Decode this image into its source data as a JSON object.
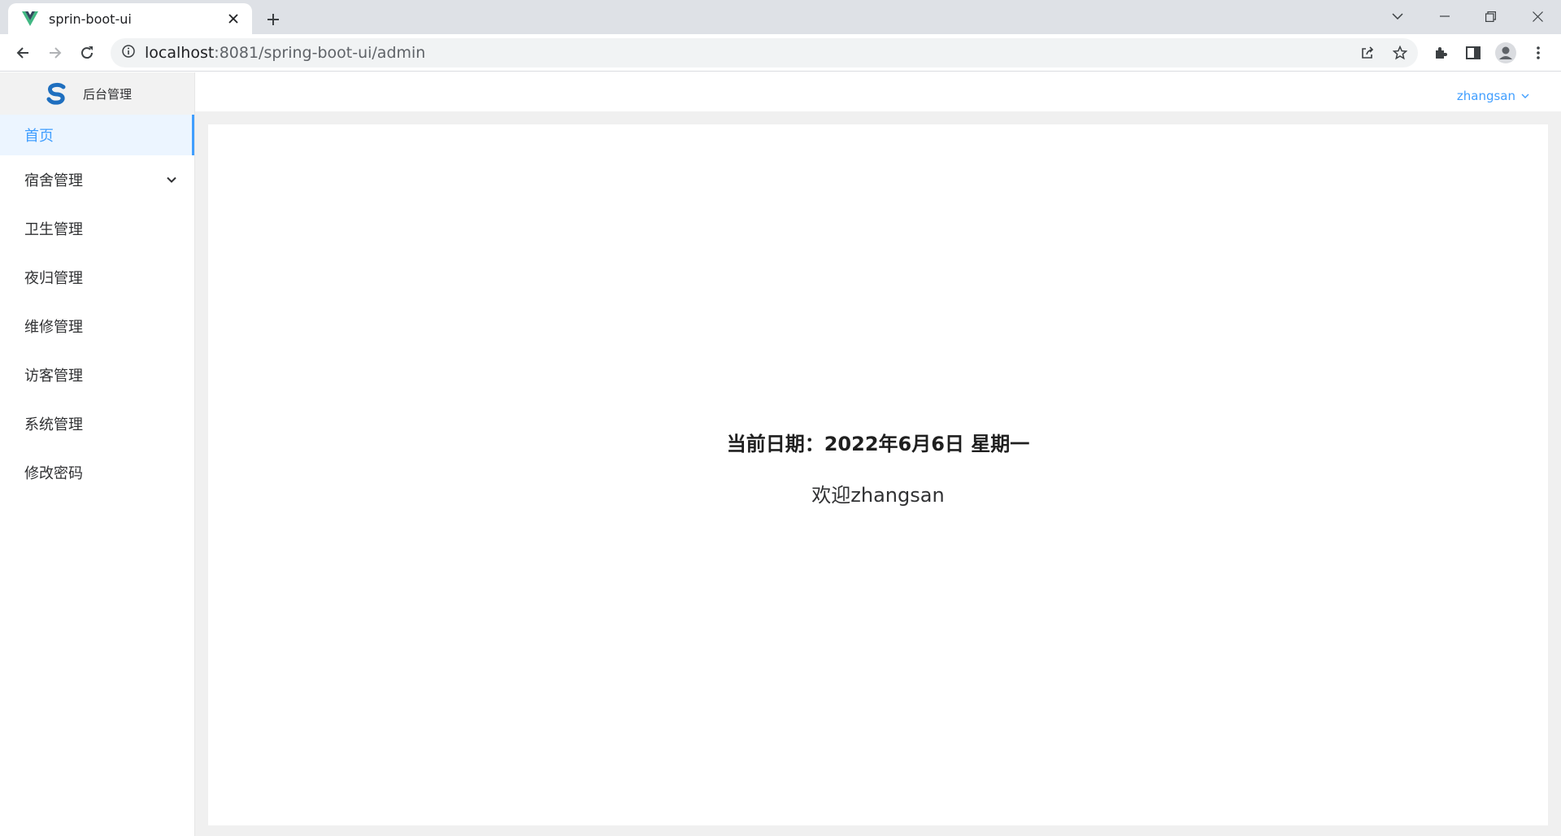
{
  "browser": {
    "tab_title": "sprin-boot-ui",
    "url_host": "localhost",
    "url_rest": ":8081/spring-boot-ui/admin"
  },
  "app": {
    "logo_text": "后台管理",
    "user_name": "zhangsan",
    "accent_color": "#409eff"
  },
  "sidebar": {
    "items": [
      {
        "label": "首页",
        "active": true
      },
      {
        "label": "宿舍管理",
        "has_submenu": true
      },
      {
        "label": "卫生管理"
      },
      {
        "label": "夜归管理"
      },
      {
        "label": "维修管理"
      },
      {
        "label": "访客管理"
      },
      {
        "label": "系统管理"
      },
      {
        "label": "修改密码"
      }
    ]
  },
  "main": {
    "date_line": "当前日期：2022年6月6日 星期一",
    "welcome": "欢迎zhangsan"
  }
}
